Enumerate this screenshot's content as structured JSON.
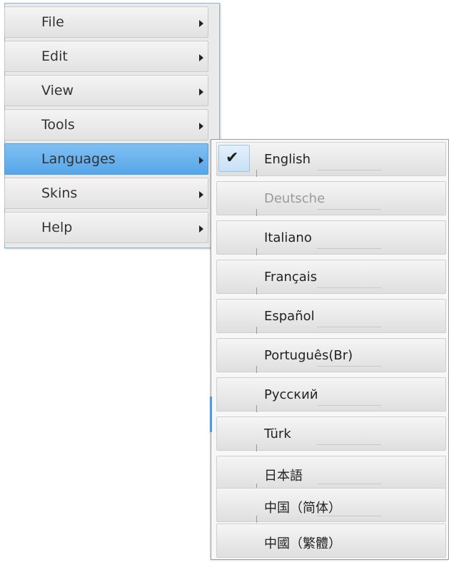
{
  "main_menu": {
    "items": [
      {
        "label": "File"
      },
      {
        "label": "Edit"
      },
      {
        "label": "View"
      },
      {
        "label": "Tools"
      },
      {
        "label": "Languages",
        "active": true
      },
      {
        "label": "Skins"
      },
      {
        "label": "Help"
      }
    ]
  },
  "languages_submenu": {
    "items": [
      {
        "label": "English",
        "checked": true
      },
      {
        "label": "Deutsche",
        "disabled": true
      },
      {
        "label": "Italiano"
      },
      {
        "label": "Français"
      },
      {
        "label": "Español"
      },
      {
        "label": "Português(Br)"
      },
      {
        "label": "Русский"
      },
      {
        "label": "Türk"
      },
      {
        "label": "日本語"
      },
      {
        "label": "中国（简体）"
      },
      {
        "label": "中國（繁體）"
      }
    ]
  },
  "colors": {
    "active_highlight": "#57a6e9",
    "menu_background": "#eaeaea",
    "disabled_text": "#9a9a9a"
  },
  "icons": {
    "checked_item": "check-icon",
    "submenu_indicator": "submenu-arrow-icon"
  }
}
